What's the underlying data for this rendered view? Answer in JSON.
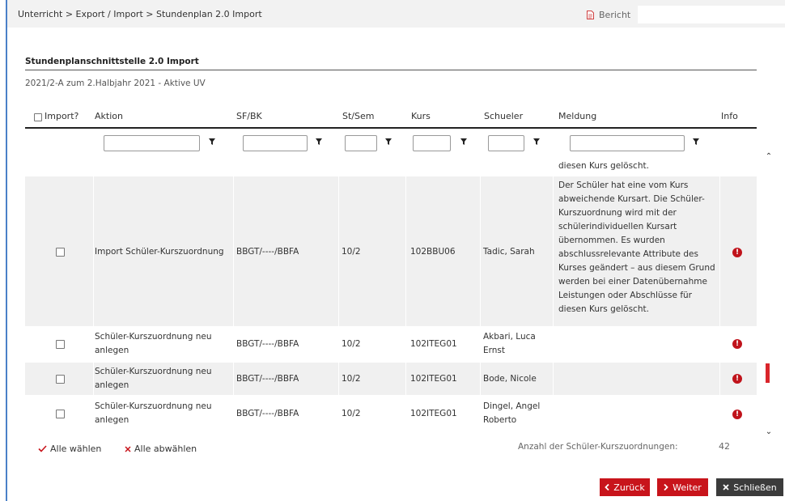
{
  "breadcrumb": "Unterricht > Export / Import > Stundenplan 2.0 Import",
  "report": {
    "label": "Bericht",
    "icon": "document-icon",
    "placeholder": ""
  },
  "section": {
    "title": "Stundenplanschnittstelle 2.0 Import",
    "subtitle": "2021/2-A zum 2.Halbjahr 2021 - Aktive UV"
  },
  "table": {
    "headers": {
      "import": "Import?",
      "aktion": "Aktion",
      "sfbk": "SF/BK",
      "stsem": "St/Sem",
      "kurs": "Kurs",
      "schueler": "Schueler",
      "meldung": "Meldung",
      "info": "Info"
    },
    "filter_icon": "filter-icon",
    "partial_top_message": "diesen Kurs gelöscht.",
    "rows": [
      {
        "aktion": [
          "Import Schüler-Kurszuordnung"
        ],
        "sfbk": "BBGT/----/BBFA",
        "stsem": "10/2",
        "kurs": "102BBU06",
        "schueler": [
          "Tadic, Sarah"
        ],
        "meldung": [
          "Der Schüler hat eine vom Kurs",
          "abweichende Kursart. Die Schüler-",
          "Kurszuordnung wird mit der",
          "schülerindividuellen Kursart",
          "übernommen. Es wurden",
          "abschlussrelevante Attribute des",
          "Kurses geändert – aus diesem Grund",
          "werden bei einer Datenübernahme",
          "Leistungen oder Abschlüsse für",
          "diesen Kurs gelöscht."
        ],
        "info_icon": "exclamation-circle-icon"
      },
      {
        "aktion": [
          "Schüler-Kurszuordnung neu",
          "anlegen"
        ],
        "sfbk": "BBGT/----/BBFA",
        "stsem": "10/2",
        "kurs": "102ITEG01",
        "schueler": [
          "Akbari, Luca",
          "Ernst"
        ],
        "meldung": [],
        "info_icon": "exclamation-circle-icon"
      },
      {
        "aktion": [
          "Schüler-Kurszuordnung neu",
          "anlegen"
        ],
        "sfbk": "BBGT/----/BBFA",
        "stsem": "10/2",
        "kurs": "102ITEG01",
        "schueler": [
          "Bode, Nicole"
        ],
        "meldung": [],
        "info_icon": "exclamation-circle-icon"
      },
      {
        "aktion": [
          "Schüler-Kurszuordnung neu",
          "anlegen"
        ],
        "sfbk": "BBGT/----/BBFA",
        "stsem": "10/2",
        "kurs": "102ITEG01",
        "schueler": [
          "Dingel, Angel",
          "Roberto"
        ],
        "meldung": [],
        "info_icon": "exclamation-circle-icon"
      }
    ]
  },
  "footer": {
    "select_all": "Alle wählen",
    "select_all_icon": "check-icon",
    "deselect_all": "Alle abwählen",
    "deselect_all_icon": "x-icon",
    "count_label": "Anzahl der Schüler-Kurszuordnungen:",
    "count": "42"
  },
  "buttons": {
    "back": "Zurück",
    "back_icon": "chevron-left-icon",
    "next": "Weiter",
    "next_icon": "chevron-right-icon",
    "close": "Schließen",
    "close_icon": "close-icon"
  },
  "colors": {
    "accent": "#c8141b",
    "dark_button": "#3b3b3b",
    "left_border": "#4a80c8",
    "row_alt": "#f0f0f0"
  }
}
